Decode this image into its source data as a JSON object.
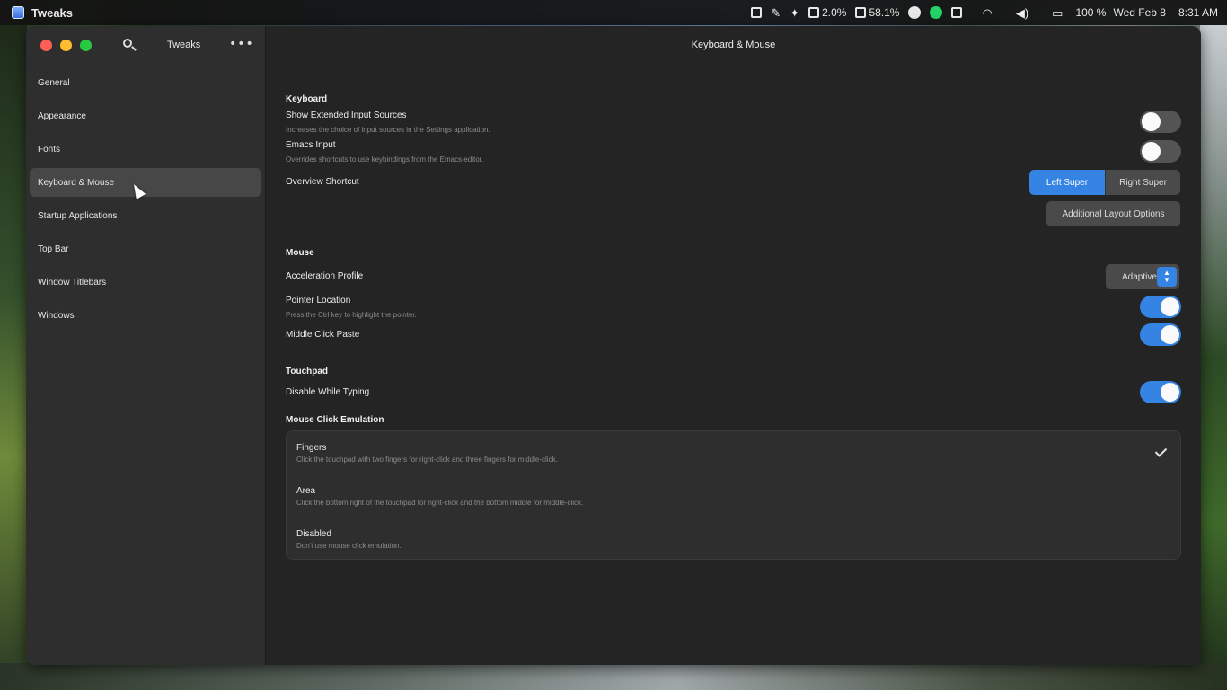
{
  "topbar": {
    "app_name": "Tweaks",
    "cpu": "2.0%",
    "memory": "58.1%",
    "battery": "100 %",
    "date": "Wed Feb 8",
    "time": "8:31 AM"
  },
  "sidebar": {
    "title": "Tweaks",
    "items": [
      {
        "label": "General"
      },
      {
        "label": "Appearance"
      },
      {
        "label": "Fonts"
      },
      {
        "label": "Keyboard & Mouse"
      },
      {
        "label": "Startup Applications"
      },
      {
        "label": "Top Bar"
      },
      {
        "label": "Window Titlebars"
      },
      {
        "label": "Windows"
      }
    ],
    "active_index": 3
  },
  "main": {
    "title": "Keyboard & Mouse",
    "keyboard": {
      "section": "Keyboard",
      "extended_sources_label": "Show Extended Input Sources",
      "extended_sources_desc": "Increases the choice of input sources in the Settings application.",
      "emacs_label": "Emacs Input",
      "emacs_desc": "Overrides shortcuts to use keybindings from the Emacs editor.",
      "overview_label": "Overview Shortcut",
      "left_super": "Left Super",
      "right_super": "Right Super",
      "layout_options": "Additional Layout Options"
    },
    "mouse": {
      "section": "Mouse",
      "accel_label": "Acceleration Profile",
      "accel_value": "Adaptive",
      "pointer_label": "Pointer Location",
      "pointer_desc": "Press the Ctrl key to highlight the pointer.",
      "middle_label": "Middle Click Paste"
    },
    "touchpad": {
      "section": "Touchpad",
      "dwt_label": "Disable While Typing"
    },
    "emulation": {
      "section": "Mouse Click Emulation",
      "options": [
        {
          "label": "Fingers",
          "desc": "Click the touchpad with two fingers for right-click and three fingers for middle-click."
        },
        {
          "label": "Area",
          "desc": "Click the bottom right of the touchpad for right-click and the bottom middle for middle-click."
        },
        {
          "label": "Disabled",
          "desc": "Don't use mouse click emulation."
        }
      ],
      "selected": "Fingers"
    }
  },
  "states": {
    "extended_sources": false,
    "emacs_input": false,
    "pointer_location": true,
    "middle_click_paste": true,
    "disable_while_typing": true,
    "overview_shortcut": "Left Super"
  },
  "colors": {
    "accent": "#3584e4",
    "window_bg": "#242424",
    "sidebar_bg": "#2e2e2e"
  }
}
